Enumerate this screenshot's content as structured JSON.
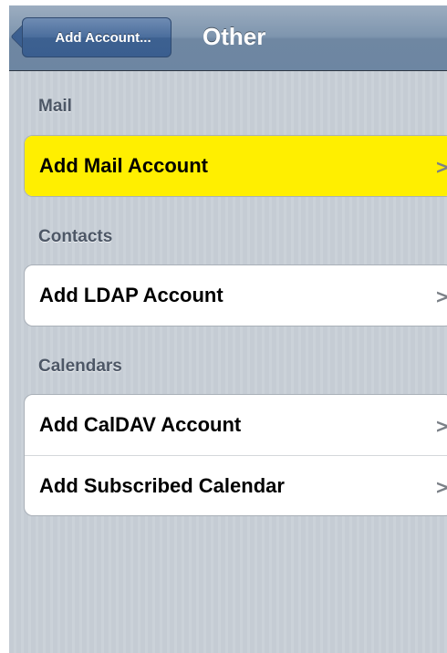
{
  "navbar": {
    "back_label": "Add Account...",
    "title": "Other"
  },
  "sections": [
    {
      "header": "Mail",
      "items": [
        {
          "label": "Add Mail Account",
          "chevron": ">"
        }
      ]
    },
    {
      "header": "Contacts",
      "items": [
        {
          "label": "Add LDAP Account",
          "chevron": ">"
        }
      ]
    },
    {
      "header": "Calendars",
      "items": [
        {
          "label": "Add CalDAV Account",
          "chevron": ">"
        },
        {
          "label": "Add Subscribed Calendar",
          "chevron": ">"
        }
      ]
    }
  ],
  "colors": {
    "highlight": "#ffef00",
    "navbar": "#7e95ae",
    "background": "#c5ccd4",
    "section_header": "#4d5766"
  },
  "icons": {
    "back": "back-arrow-icon",
    "disclosure": "chevron-right-icon"
  }
}
